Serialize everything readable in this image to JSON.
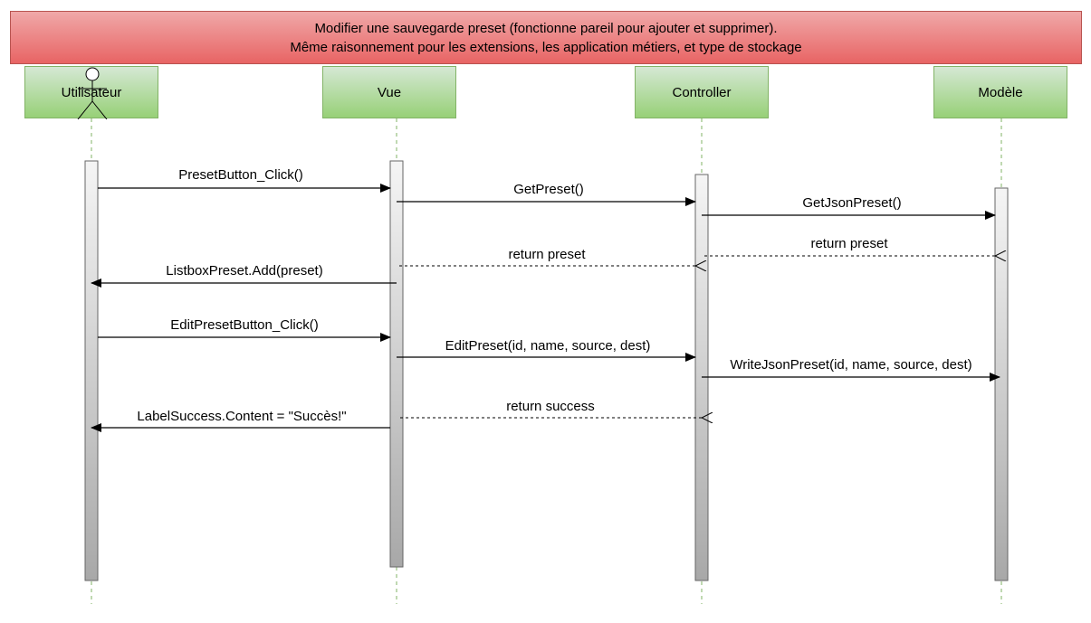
{
  "title": {
    "line1": "Modifier une sauvegarde preset (fonctionne pareil pour ajouter et supprimer).",
    "line2": "Même raisonnement pour les extensions, les application métiers, et type de stockage"
  },
  "participants": [
    {
      "label": "Utilisateur"
    },
    {
      "label": "Vue"
    },
    {
      "label": "Controller"
    },
    {
      "label": "Modèle"
    }
  ],
  "messages": [
    {
      "label": "PresetButton_Click()",
      "from": 0,
      "to": 1,
      "kind": "call"
    },
    {
      "label": "GetPreset()",
      "from": 1,
      "to": 2,
      "kind": "call"
    },
    {
      "label": "GetJsonPreset()",
      "from": 2,
      "to": 3,
      "kind": "call"
    },
    {
      "label": "return preset",
      "from": 3,
      "to": 2,
      "kind": "return"
    },
    {
      "label": "return preset",
      "from": 2,
      "to": 1,
      "kind": "return"
    },
    {
      "label": "ListboxPreset.Add(preset)",
      "from": 1,
      "to": 0,
      "kind": "call"
    },
    {
      "label": "EditPresetButton_Click()",
      "from": 0,
      "to": 1,
      "kind": "call"
    },
    {
      "label": "EditPreset(id, name, source, dest)",
      "from": 1,
      "to": 2,
      "kind": "call"
    },
    {
      "label": "WriteJsonPreset(id, name, source, dest)",
      "from": 2,
      "to": 3,
      "kind": "call"
    },
    {
      "label": "return success",
      "from": 2,
      "to": 1,
      "kind": "return"
    },
    {
      "label": "LabelSuccess.Content = \"Succès!\"",
      "from": 1,
      "to": 0,
      "kind": "call"
    }
  ],
  "colors": {
    "title_fill_top": "#f0a8a8",
    "title_fill_bottom": "#e86464",
    "participant_fill_top": "#d5e8d4",
    "participant_fill_bottom": "#97d077",
    "lifeline": "#82b366",
    "activation_top": "#f5f5f5",
    "activation_bottom": "#a8a8a8"
  }
}
